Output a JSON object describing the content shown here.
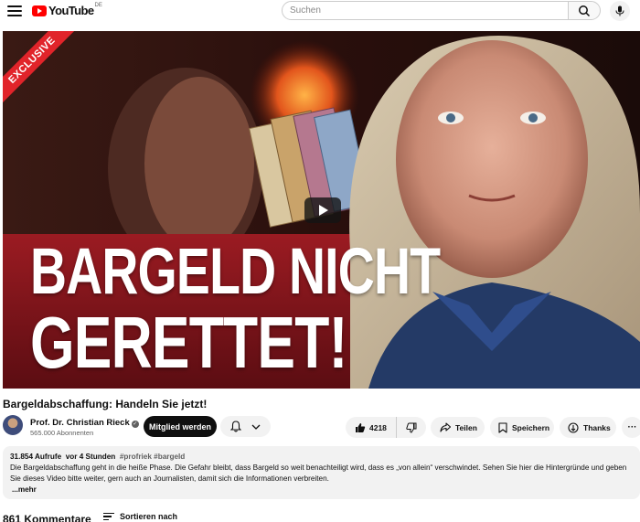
{
  "header": {
    "logo_text": "YouTube",
    "logo_country": "DE",
    "search_placeholder": "Suchen",
    "icons": [
      "menu-icon",
      "search-icon",
      "mic-icon"
    ]
  },
  "video": {
    "ribbon": "EXCLUSIVE",
    "headline_line1": "BARGELD NICHT",
    "headline_line2": "GERETTET!",
    "title": "Bargeldabschaffung: Handeln Sie jetzt!"
  },
  "channel": {
    "name": "Prof. Dr. Christian Rieck",
    "subscribers": "565.000 Abonnenten",
    "member_button": "Mitglied werden"
  },
  "actions": {
    "likes": "4218",
    "share": "Teilen",
    "save": "Speichern",
    "thanks": "Thanks",
    "more": "···"
  },
  "description": {
    "views": "31.854 Aufrufe",
    "age": "vor 4 Stunden",
    "tags": "#profriek #bargeld",
    "text": "Die Bargeldabschaffung geht in die heiße Phase. Die Gefahr bleibt, dass Bargeld so weit benachteiligt wird, dass es „von allein“ verschwindet. Sehen Sie hier die Hintergründe und geben Sie dieses Video bitte weiter, gern auch an Journalisten, damit sich die Informationen verbreiten.",
    "more_label": "...mehr"
  },
  "comments": {
    "count": "861 Kommentare",
    "sort_label": "Sortieren nach"
  },
  "colors": {
    "brand_red": "#ff0000",
    "ribbon_red": "#e1242a",
    "button_dark": "#0f0f0f",
    "chip_bg": "#f2f2f2"
  }
}
